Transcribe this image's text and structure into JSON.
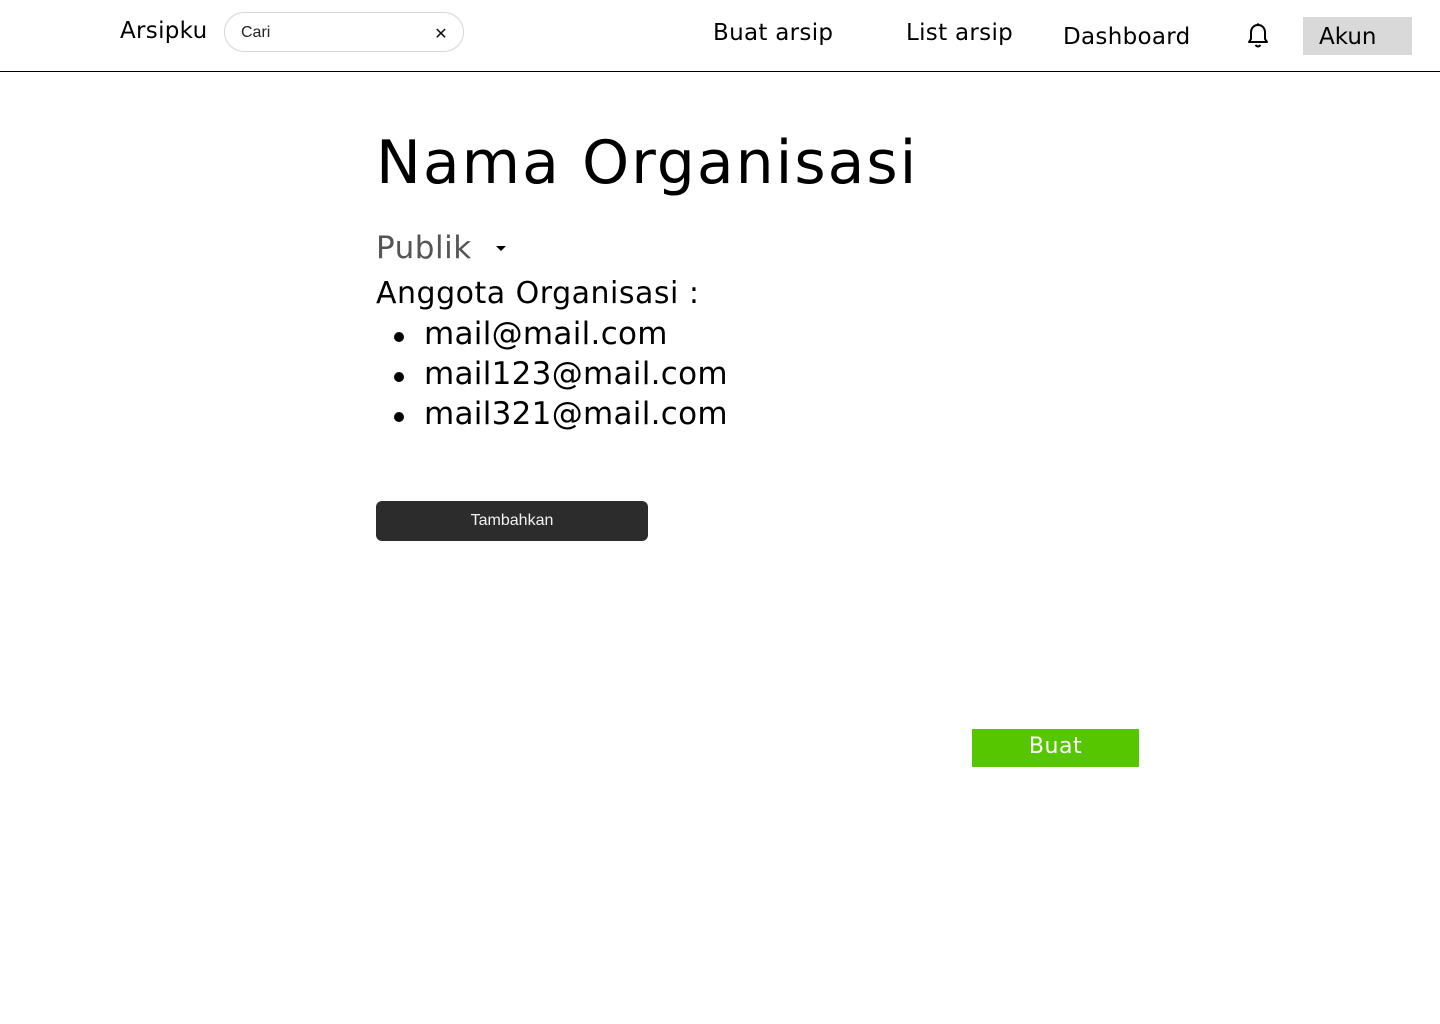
{
  "header": {
    "brand": "Arsipku",
    "search_placeholder": "Cari",
    "nav": {
      "create_archive": "Buat arsip",
      "archive_list": "List arsip",
      "dashboard": "Dashboard"
    },
    "bell_icon": "bell-icon",
    "clear_icon": "close-icon",
    "account": "Akun"
  },
  "main": {
    "title": "Nama Organisasi",
    "visibility": "Publik",
    "caret_icon": "caret-down-icon",
    "members_label": "Anggota Organisasi :",
    "members": [
      "mail@mail.com",
      "mail123@mail.com",
      "mail321@mail.com"
    ],
    "add_button": "Tambahkan",
    "create_button": "Buat"
  },
  "colors": {
    "create_button_bg": "#55c600",
    "add_button_bg": "#2c2c2c",
    "account_bg": "#d9d9d9"
  }
}
